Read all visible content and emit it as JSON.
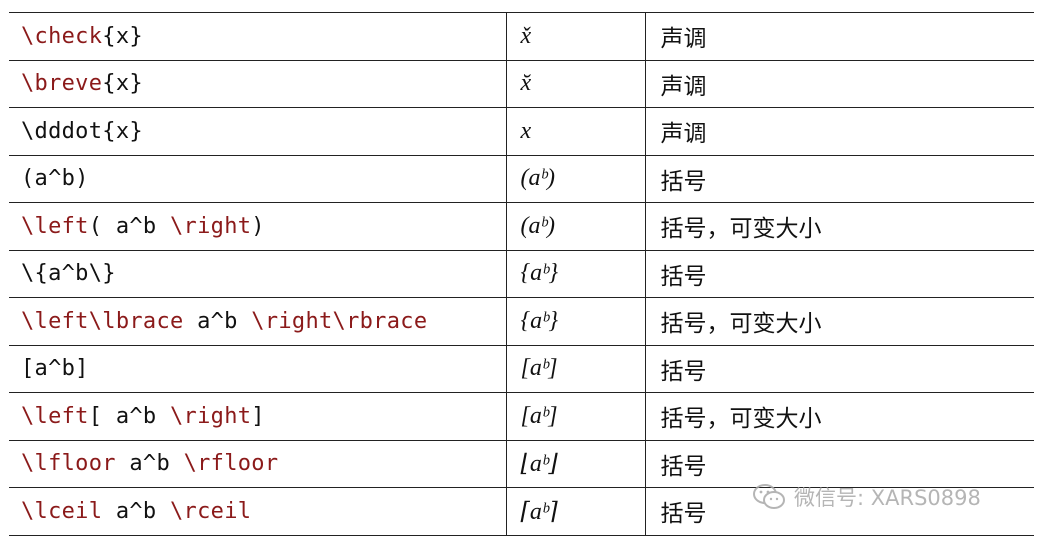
{
  "rows": [
    {
      "cmd": [
        {
          "t": "\\check",
          "kw": true
        },
        {
          "t": "{x}",
          "kw": false
        }
      ],
      "output": "x̌",
      "desc": "声调"
    },
    {
      "cmd": [
        {
          "t": "\\breve",
          "kw": true
        },
        {
          "t": "{x}",
          "kw": false
        }
      ],
      "output": "x̆",
      "desc": "声调"
    },
    {
      "cmd": [
        {
          "t": "\\dddot{x}",
          "kw": false
        }
      ],
      "output": "x⃛",
      "desc": "声调"
    },
    {
      "cmd": [
        {
          "t": "(a^b)",
          "kw": false
        }
      ],
      "output": "(aᵇ)",
      "desc": "括号"
    },
    {
      "cmd": [
        {
          "t": "\\left",
          "kw": true
        },
        {
          "t": "( a^b ",
          "kw": false
        },
        {
          "t": "\\right",
          "kw": true
        },
        {
          "t": ")",
          "kw": false
        }
      ],
      "output": "(aᵇ)",
      "desc": "括号，可变大小"
    },
    {
      "cmd": [
        {
          "t": "\\{a^b\\}",
          "kw": false
        }
      ],
      "output": "{aᵇ}",
      "desc": "括号"
    },
    {
      "cmd": [
        {
          "t": "\\left\\lbrace",
          "kw": true
        },
        {
          "t": " a^b ",
          "kw": false
        },
        {
          "t": "\\right\\rbrace",
          "kw": true
        }
      ],
      "output": "{aᵇ}",
      "desc": "括号，可变大小"
    },
    {
      "cmd": [
        {
          "t": "[a^b]",
          "kw": false
        }
      ],
      "output": "[aᵇ]",
      "desc": "括号"
    },
    {
      "cmd": [
        {
          "t": "\\left",
          "kw": true
        },
        {
          "t": "[ a^b ",
          "kw": false
        },
        {
          "t": "\\right",
          "kw": true
        },
        {
          "t": "]",
          "kw": false
        }
      ],
      "output": "[aᵇ]",
      "desc": "括号，可变大小"
    },
    {
      "cmd": [
        {
          "t": "\\lfloor",
          "kw": true
        },
        {
          "t": " a^b ",
          "kw": false
        },
        {
          "t": "\\rfloor",
          "kw": true
        }
      ],
      "output": "⌊aᵇ⌋",
      "desc": "括号"
    },
    {
      "cmd": [
        {
          "t": "\\lceil",
          "kw": true
        },
        {
          "t": " a^b ",
          "kw": false
        },
        {
          "t": "\\rceil",
          "kw": true
        }
      ],
      "output": "⌈aᵇ⌉",
      "desc": "括号"
    }
  ],
  "watermark": {
    "icon": "wechat-icon",
    "text": "微信号: XARS0898",
    "color": "#a9a9a9"
  },
  "colors": {
    "command_keyword": "#8b1a1a",
    "text": "#111111",
    "rule": "#222222"
  }
}
